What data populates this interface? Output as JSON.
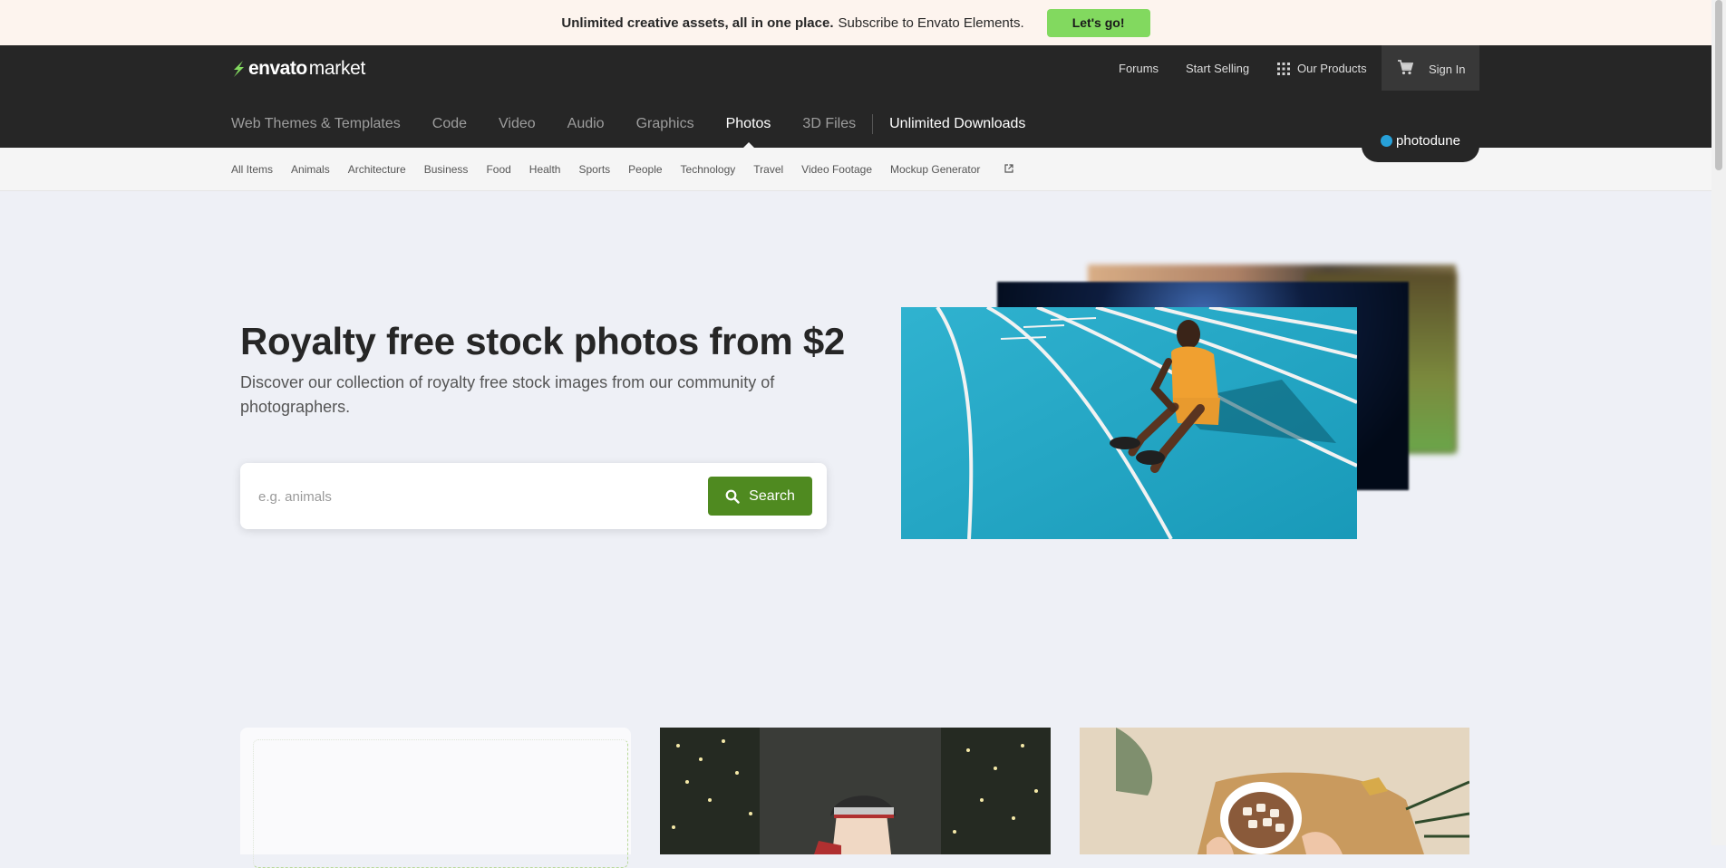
{
  "promo": {
    "bold_text": "Unlimited creative assets, all in one place.",
    "text": "Subscribe to Envato Elements.",
    "button": "Let's go!"
  },
  "logo": {
    "word1": "envato",
    "word2": "market"
  },
  "topnav": {
    "forums": "Forums",
    "start_selling": "Start Selling",
    "our_products": "Our Products",
    "sign_in": "Sign In"
  },
  "categories": {
    "web_themes": "Web Themes & Templates",
    "code": "Code",
    "video": "Video",
    "audio": "Audio",
    "graphics": "Graphics",
    "photos": "Photos",
    "files_3d": "3D Files",
    "unlimited": "Unlimited Downloads",
    "active": "Photos"
  },
  "badge": "photodune",
  "subnav": {
    "all_items": "All Items",
    "animals": "Animals",
    "architecture": "Architecture",
    "business": "Business",
    "food": "Food",
    "health": "Health",
    "sports": "Sports",
    "people": "People",
    "technology": "Technology",
    "travel": "Travel",
    "video_footage": "Video Footage",
    "mockup_generator": "Mockup Generator"
  },
  "hero": {
    "title": "Royalty free stock photos from $2",
    "subtitle": "Discover our collection of royalty free stock images from our community of photographers.",
    "search_placeholder": "e.g. animals",
    "search_button": "Search"
  },
  "colors": {
    "accent_green": "#82d95f",
    "search_green": "#4f8a20",
    "header_dark": "#262626",
    "track_blue": "#1fa8c8"
  },
  "icons": [
    "grid-icon",
    "cart-icon",
    "external-link-icon",
    "search-icon"
  ]
}
